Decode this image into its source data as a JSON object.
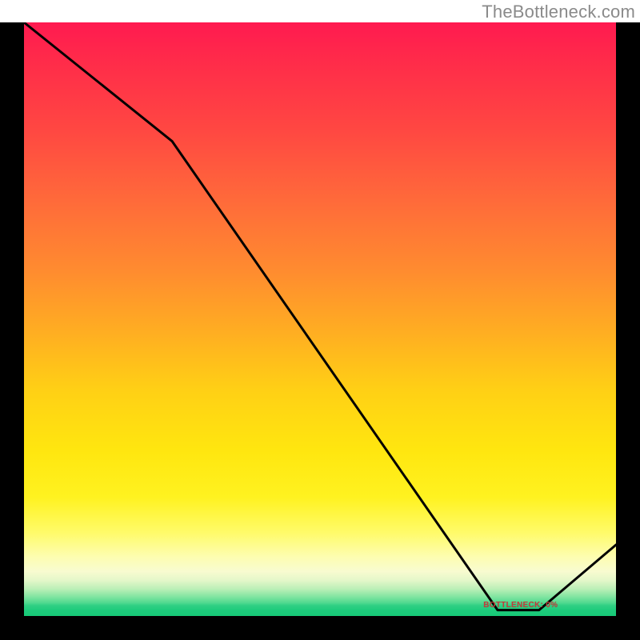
{
  "attribution": "TheBottleneck.com",
  "bottleneck_label": "BOTTLENECK: 0%",
  "chart_data": {
    "type": "line",
    "title": "",
    "xlabel": "",
    "ylabel": "",
    "xlim": [
      0,
      100
    ],
    "ylim": [
      0,
      100
    ],
    "series": [
      {
        "name": "bottleneck-curve",
        "x": [
          0,
          25,
          80,
          87,
          100
        ],
        "y": [
          100,
          80,
          1,
          1,
          12
        ]
      }
    ],
    "annotations": [
      {
        "text": "BOTTLENECK: 0%",
        "x": 83,
        "y": 1.7
      }
    ],
    "gradient_stops": [
      {
        "pos": 0,
        "color": "#ff1a50"
      },
      {
        "pos": 0.5,
        "color": "#ffad22"
      },
      {
        "pos": 0.8,
        "color": "#fff220"
      },
      {
        "pos": 0.93,
        "color": "#f5fbcf"
      },
      {
        "pos": 0.97,
        "color": "#7fe4a0"
      },
      {
        "pos": 1.0,
        "color": "#17c977"
      }
    ]
  }
}
